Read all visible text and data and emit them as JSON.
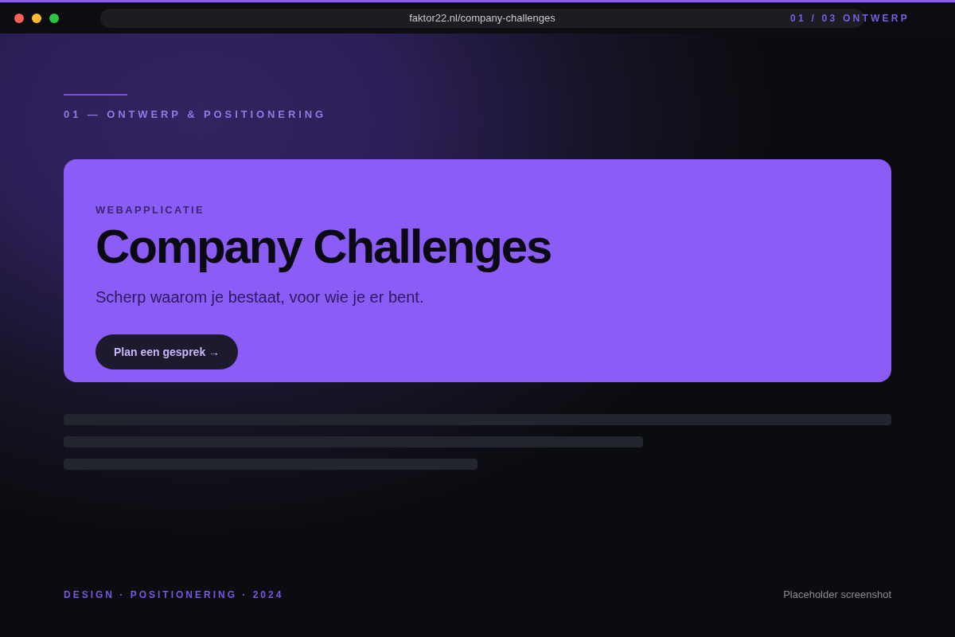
{
  "browser": {
    "url": "faktor22.nl/company-challenges",
    "progress_label": "01 / 03 ONTWERP"
  },
  "section": {
    "eyebrow": "01 — ONTWERP & POSITIONERING"
  },
  "card": {
    "category": "WEBAPPLICATIE",
    "title": "Company Challenges",
    "tagline": "Scherp waarom je bestaat, voor wie je er bent.",
    "button": {
      "label": "Plan een gesprek →"
    }
  },
  "footer": {
    "tags": "DESIGN · POSITIONERING · 2024",
    "note": "Placeholder screenshot"
  }
}
